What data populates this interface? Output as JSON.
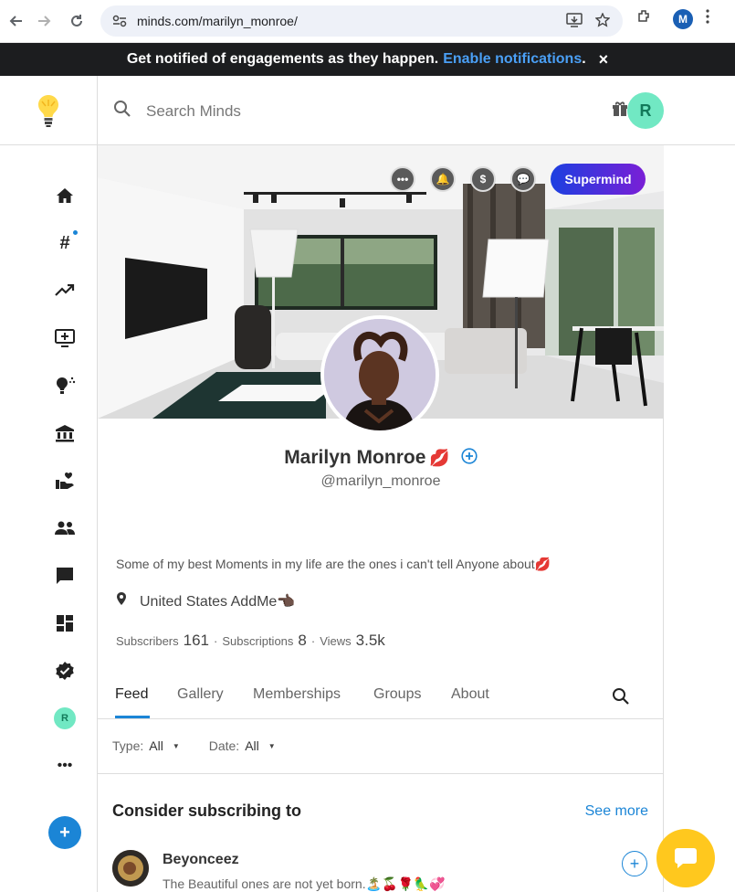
{
  "browser": {
    "url": "minds.com/marilyn_monroe/",
    "profile_initial": "M"
  },
  "notification_banner": {
    "text": "Get notified of engagements as they happen.",
    "link": "Enable notifications",
    "suffix": ".",
    "close": "×"
  },
  "topbar": {
    "search_placeholder": "Search Minds",
    "user_initial": "R"
  },
  "sidebar": {
    "items": [
      "home-icon",
      "hashtag-icon",
      "trending-icon",
      "boost-icon",
      "plus-icon",
      "treasury-icon",
      "supermind-icon",
      "groups-icon",
      "chat-icon",
      "canary-icon",
      "verified-icon",
      "user-avatar",
      "more-icon"
    ],
    "user_initial": "R",
    "more": "•••",
    "compose": "+"
  },
  "channel": {
    "supermind_label": "Supermind",
    "channel_buttons": [
      "•••",
      "🔔",
      "$",
      "💬"
    ],
    "name": "Marilyn Monroe",
    "name_emoji": "💋",
    "handle": "@marilyn_monroe",
    "bio": "Some of my best Moments in my life are the ones i can't tell Anyone about💋",
    "location": "United States AddMe👈🏿",
    "stats": {
      "subscribers_label": "Subscribers",
      "subscribers": "161",
      "subscriptions_label": "Subscriptions",
      "subscriptions": "8",
      "views_label": "Views",
      "views": "3.5k",
      "sep": "·"
    }
  },
  "tabs": [
    "Feed",
    "Gallery",
    "Memberships",
    "Groups",
    "About"
  ],
  "filters": {
    "type_label": "Type:",
    "type_value": "All",
    "date_label": "Date:",
    "date_value": "All"
  },
  "suggestions": {
    "title": "Consider subscribing to",
    "see_more": "See more",
    "items": [
      {
        "name": "Beyonceez",
        "bio": "The Beautiful ones are not yet born.🏝️🍒🌹🦜💞"
      }
    ]
  },
  "colors": {
    "accent": "#1b85d6",
    "supermind_start": "#1c3fe0",
    "supermind_end": "#7a1fd6",
    "avatar_green": "#71e8c3",
    "chat_yellow": "#ffc81e"
  }
}
